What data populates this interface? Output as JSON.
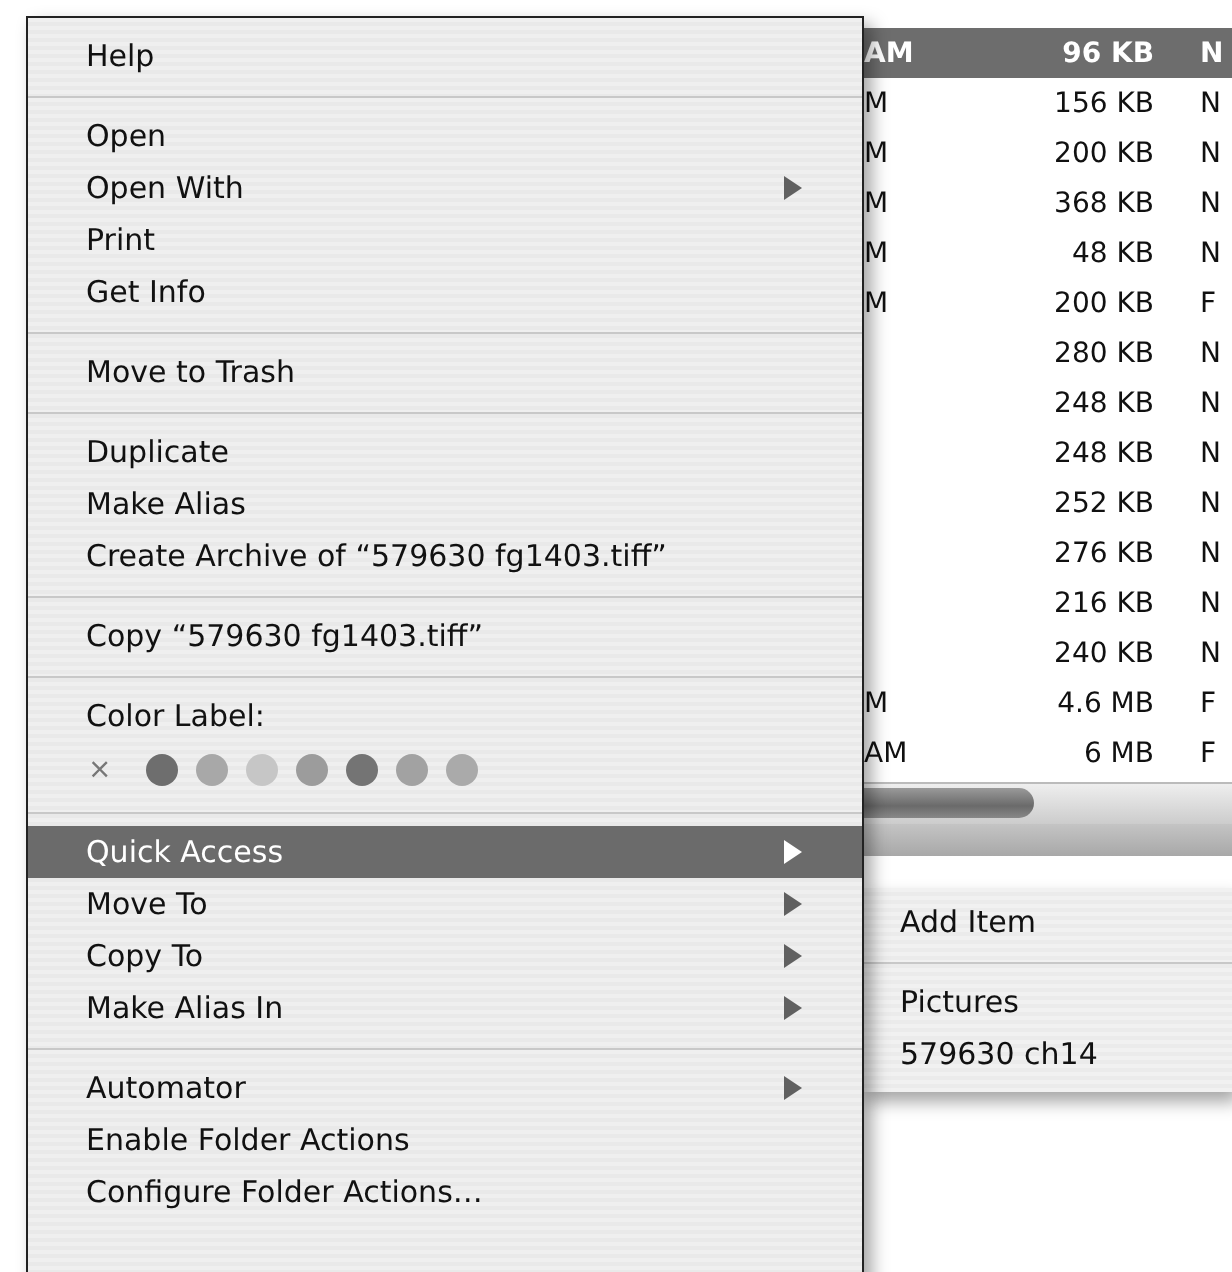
{
  "context_menu": {
    "items": [
      {
        "kind": "item",
        "label": "Help",
        "submenu": false,
        "selected": false
      },
      {
        "kind": "separator"
      },
      {
        "kind": "item",
        "label": "Open",
        "submenu": false,
        "selected": false
      },
      {
        "kind": "item",
        "label": "Open With",
        "submenu": true,
        "selected": false
      },
      {
        "kind": "item",
        "label": "Print",
        "submenu": false,
        "selected": false
      },
      {
        "kind": "item",
        "label": "Get Info",
        "submenu": false,
        "selected": false
      },
      {
        "kind": "separator"
      },
      {
        "kind": "item",
        "label": "Move to Trash",
        "submenu": false,
        "selected": false
      },
      {
        "kind": "separator"
      },
      {
        "kind": "item",
        "label": "Duplicate",
        "submenu": false,
        "selected": false
      },
      {
        "kind": "item",
        "label": "Make Alias",
        "submenu": false,
        "selected": false
      },
      {
        "kind": "item",
        "label": "Create Archive of “579630 fg1403.tiff”",
        "submenu": false,
        "selected": false
      },
      {
        "kind": "separator"
      },
      {
        "kind": "item",
        "label": "Copy “579630 fg1403.tiff”",
        "submenu": false,
        "selected": false
      },
      {
        "kind": "separator"
      },
      {
        "kind": "label",
        "label": "Color Label:"
      },
      {
        "kind": "colors",
        "clear": "×",
        "colors": [
          {
            "color": "#6e6e6e"
          },
          {
            "color": "#a8a8a8"
          },
          {
            "color": "#c6c6c6"
          },
          {
            "color": "#9c9c9c"
          },
          {
            "color": "#747474"
          },
          {
            "color": "#a2a2a2"
          },
          {
            "color": "#aaaaaa"
          }
        ]
      },
      {
        "kind": "separator"
      },
      {
        "kind": "item",
        "label": "Quick Access",
        "submenu": true,
        "selected": true
      },
      {
        "kind": "item",
        "label": "Move To",
        "submenu": true,
        "selected": false
      },
      {
        "kind": "item",
        "label": "Copy To",
        "submenu": true,
        "selected": false
      },
      {
        "kind": "item",
        "label": "Make Alias In",
        "submenu": true,
        "selected": false
      },
      {
        "kind": "separator"
      },
      {
        "kind": "item",
        "label": "Automator",
        "submenu": true,
        "selected": false
      },
      {
        "kind": "item",
        "label": "Enable Folder Actions",
        "submenu": false,
        "selected": false
      },
      {
        "kind": "item",
        "label": "Configure Folder Actions…",
        "submenu": false,
        "selected": false
      }
    ]
  },
  "file_list": {
    "rows": [
      {
        "date": "AM",
        "size": "96 KB",
        "kind": "N",
        "selected": true
      },
      {
        "date": "M",
        "size": "156 KB",
        "kind": "N",
        "selected": false
      },
      {
        "date": "M",
        "size": "200 KB",
        "kind": "N",
        "selected": false
      },
      {
        "date": "M",
        "size": "368 KB",
        "kind": "N",
        "selected": false
      },
      {
        "date": "M",
        "size": "48 KB",
        "kind": "N",
        "selected": false
      },
      {
        "date": "M",
        "size": "200 KB",
        "kind": "F",
        "selected": false
      },
      {
        "size": "280 KB",
        "kind": "N",
        "selected": false
      },
      {
        "size": "248 KB",
        "kind": "N",
        "selected": false
      },
      {
        "size": "248 KB",
        "kind": "N",
        "selected": false
      },
      {
        "size": "252 KB",
        "kind": "N",
        "selected": false
      },
      {
        "size": "276 KB",
        "kind": "N",
        "selected": false
      },
      {
        "size": "216 KB",
        "kind": "N",
        "selected": false
      },
      {
        "size": "240 KB",
        "kind": "N",
        "selected": false
      },
      {
        "date": "M",
        "size": "4.6 MB",
        "kind": "F",
        "selected": false
      },
      {
        "date": "AM",
        "size": "6 MB",
        "kind": "F",
        "selected": false
      }
    ]
  },
  "submenu": {
    "items": [
      {
        "kind": "item",
        "label": "Add Item"
      },
      {
        "kind": "separator"
      },
      {
        "kind": "item",
        "label": "Pictures"
      },
      {
        "kind": "item",
        "label": "579630 ch14"
      }
    ]
  }
}
